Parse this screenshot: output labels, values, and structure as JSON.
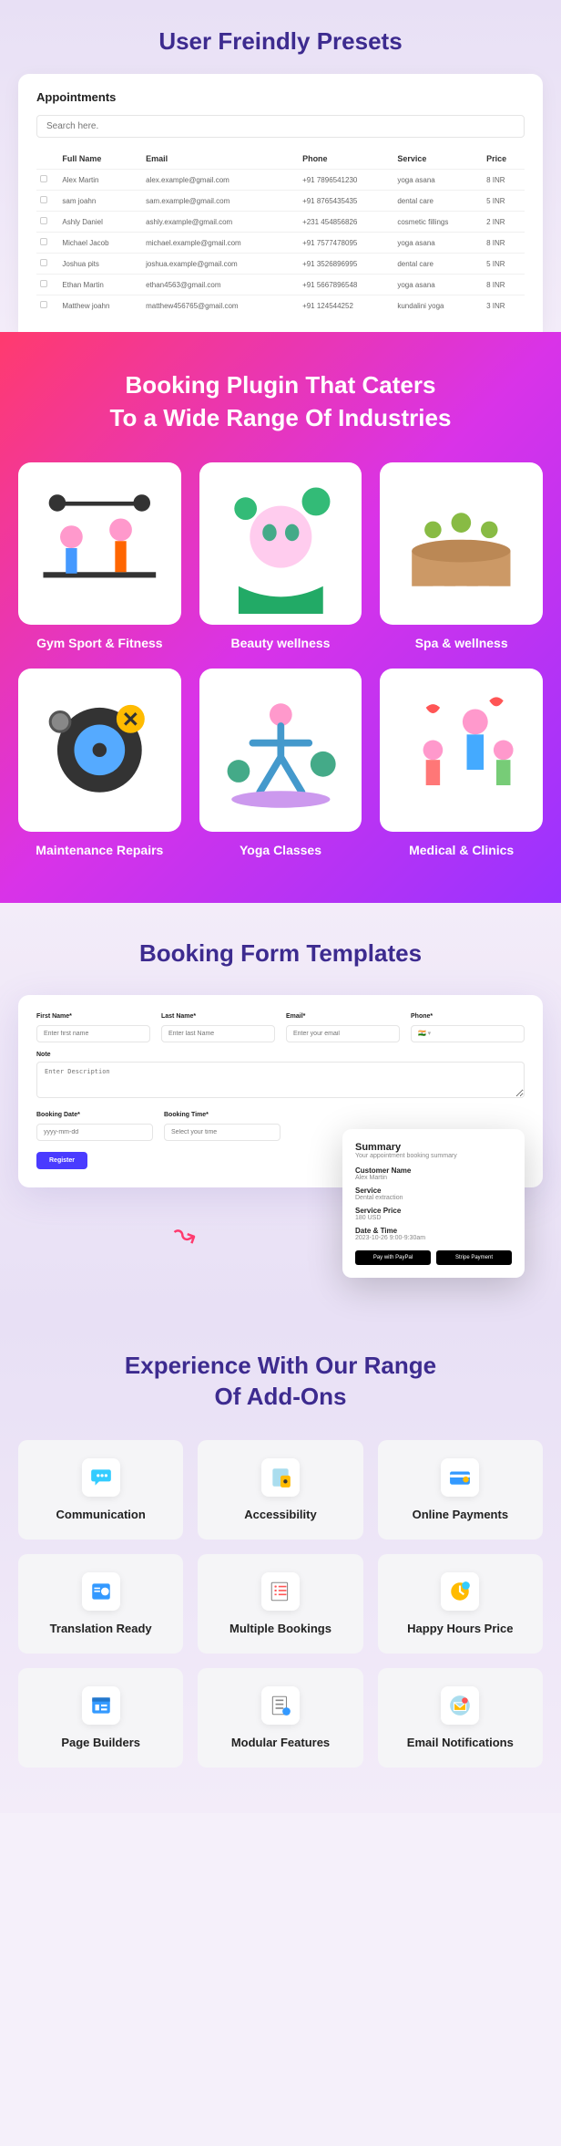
{
  "section1": {
    "title": "User Freindly Presets",
    "card_title": "Appointments",
    "search_placeholder": "Search here.",
    "headers": [
      "Full Name",
      "Email",
      "Phone",
      "Service",
      "Price"
    ],
    "rows": [
      {
        "name": "Alex Martin",
        "email": "alex.example@gmail.com",
        "phone": "+91 7896541230",
        "service": "yoga asana",
        "price": "8 INR"
      },
      {
        "name": "sam joahn",
        "email": "sam.example@gmail.com",
        "phone": "+91 8765435435",
        "service": "dental care",
        "price": "5 INR"
      },
      {
        "name": "Ashly Daniel",
        "email": "ashly.example@gmail.com",
        "phone": "+231 454856826",
        "service": "cosmetic fillings",
        "price": "2 INR"
      },
      {
        "name": "Michael Jacob",
        "email": "michael.example@gmail.com",
        "phone": "+91 7577478095",
        "service": "yoga asana",
        "price": "8 INR"
      },
      {
        "name": "Joshua pits",
        "email": "joshua.example@gmail.com",
        "phone": "+91 3526896995",
        "service": "dental care",
        "price": "5 INR"
      },
      {
        "name": "Ethan Martin",
        "email": "ethan4563@gmail.com",
        "phone": "+91 5667896548",
        "service": "yoga asana",
        "price": "8 INR"
      },
      {
        "name": "Matthew joahn",
        "email": "matthew456765@gmail.com",
        "phone": "+91 124544252",
        "service": "kundalini yoga",
        "price": "3 INR"
      }
    ]
  },
  "section2": {
    "title_l1": "Booking Plugin That Caters",
    "title_l2": "To a Wide Range Of Industries",
    "items": [
      {
        "label": "Gym Sport & Fitness",
        "icon": "gym"
      },
      {
        "label": "Beauty wellness",
        "icon": "beauty"
      },
      {
        "label": "Spa & wellness",
        "icon": "spa"
      },
      {
        "label": "Maintenance Repairs",
        "icon": "maintenance"
      },
      {
        "label": "Yoga Classes",
        "icon": "yoga"
      },
      {
        "label": "Medical & Clinics",
        "icon": "medical"
      }
    ]
  },
  "section3": {
    "title": "Booking Form Templates",
    "labels": {
      "first": "First Name*",
      "last": "Last Name*",
      "email": "Email*",
      "phone": "Phone*",
      "note": "Note",
      "date": "Booking Date*",
      "time": "Booking Time*"
    },
    "ph": {
      "first": "Enter first name",
      "last": "Enter last Name",
      "email": "Enter your email",
      "note": "Enter Description",
      "date": "yyyy-mm-dd",
      "time": "Select your time"
    },
    "register": "Register",
    "summary": {
      "title": "Summary",
      "sub": "Your appointment booking summary",
      "cust_l": "Customer Name",
      "cust_v": "Alex Martin",
      "svc_l": "Service",
      "svc_v": "Dental extraction",
      "price_l": "Service Price",
      "price_v": "180 USD",
      "date_l": "Date & Time",
      "date_v": "2023-10-26 9:00-9:30am",
      "btn1": "Pay with PayPal",
      "btn2": "Stripe Payment"
    }
  },
  "section4": {
    "title_l1": "Experience With Our Range",
    "title_l2": "Of Add-Ons",
    "items": [
      {
        "label": "Communication",
        "icon": "chat"
      },
      {
        "label": "Accessibility",
        "icon": "access"
      },
      {
        "label": "Online Payments",
        "icon": "card"
      },
      {
        "label": "Translation Ready",
        "icon": "translate"
      },
      {
        "label": "Multiple Bookings",
        "icon": "multi"
      },
      {
        "label": "Happy Hours Price",
        "icon": "hours"
      },
      {
        "label": "Page Builders",
        "icon": "builder"
      },
      {
        "label": "Modular Features",
        "icon": "modular"
      },
      {
        "label": "Email Notifications",
        "icon": "email"
      }
    ]
  }
}
